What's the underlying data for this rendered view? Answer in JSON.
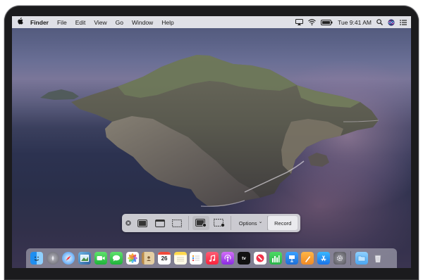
{
  "menubar": {
    "app_name": "Finder",
    "menus": [
      "File",
      "Edit",
      "View",
      "Go",
      "Window",
      "Help"
    ],
    "clock": "Tue 9:41 AM"
  },
  "toolbar": {
    "options_label": "Options",
    "options_chevron": "⌄",
    "record_label": "Record"
  },
  "dock": {
    "calendar_day": "26",
    "appletv_label": "tv"
  },
  "colors": {
    "menubar_bg": "#ebebf0",
    "toolbar_bg": "#d6d6da",
    "dock_bg": "#bebec8"
  }
}
